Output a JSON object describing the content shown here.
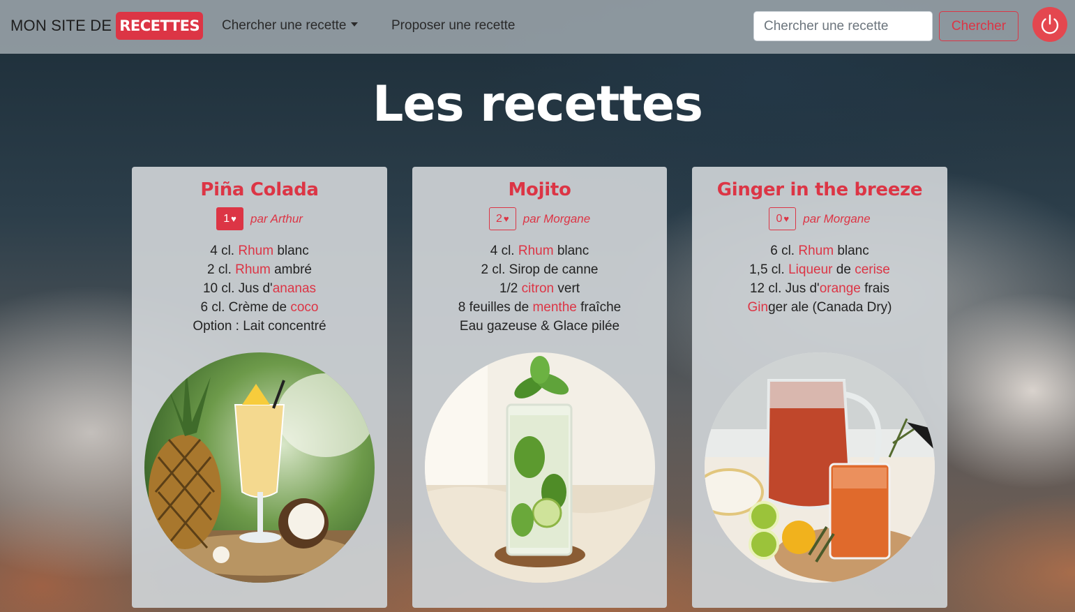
{
  "navbar": {
    "brand_prefix": "MON SITE DE",
    "brand_badge": "RECETTES",
    "menu_search_recipe": "Chercher une recette",
    "menu_propose_recipe": "Proposer une recette",
    "search_placeholder": "Chercher une recette",
    "search_button": "Chercher",
    "power_icon": "power-icon"
  },
  "page": {
    "title": "Les recettes"
  },
  "colors": {
    "accent": "#dc3545",
    "navbar": "#96a0a6",
    "card": "#ced2d5"
  },
  "recipes": [
    {
      "title": "Piña Colada",
      "likes": "1",
      "likes_filled": true,
      "author": "par Arthur",
      "ingredients": [
        [
          {
            "t": "4 cl. "
          },
          {
            "t": "Rhum",
            "h": true
          },
          {
            "t": " blanc"
          }
        ],
        [
          {
            "t": "2 cl. "
          },
          {
            "t": "Rhum",
            "h": true
          },
          {
            "t": " ambré"
          }
        ],
        [
          {
            "t": "10 cl. Jus d'"
          },
          {
            "t": "ananas",
            "h": true
          }
        ],
        [
          {
            "t": "6 cl. Crème de "
          },
          {
            "t": "coco",
            "h": true
          }
        ],
        [
          {
            "t": "Option : Lait concentré"
          }
        ]
      ],
      "image": "pina-colada-photo"
    },
    {
      "title": "Mojito",
      "likes": "2",
      "likes_filled": false,
      "author": "par Morgane",
      "ingredients": [
        [
          {
            "t": "4 cl. "
          },
          {
            "t": "Rhum",
            "h": true
          },
          {
            "t": " blanc"
          }
        ],
        [
          {
            "t": "2 cl. Sirop de canne"
          }
        ],
        [
          {
            "t": "1/2 "
          },
          {
            "t": "citron",
            "h": true
          },
          {
            "t": " vert"
          }
        ],
        [
          {
            "t": "8 feuilles de "
          },
          {
            "t": "menthe",
            "h": true
          },
          {
            "t": " fraîche"
          }
        ],
        [
          {
            "t": "Eau gazeuse & Glace pilée"
          }
        ]
      ],
      "image": "mojito-photo"
    },
    {
      "title": "Ginger in the breeze",
      "likes": "0",
      "likes_filled": false,
      "author": "par Morgane",
      "ingredients": [
        [
          {
            "t": "6 cl. "
          },
          {
            "t": "Rhum",
            "h": true
          },
          {
            "t": " blanc"
          }
        ],
        [
          {
            "t": "1,5 cl. "
          },
          {
            "t": "Liqueur",
            "h": true
          },
          {
            "t": " de "
          },
          {
            "t": "cerise",
            "h": true
          }
        ],
        [
          {
            "t": "12 cl. Jus d'"
          },
          {
            "t": "orange",
            "h": true
          },
          {
            "t": " frais"
          }
        ],
        [
          {
            "t": "Gin",
            "h": true
          },
          {
            "t": "ger ale (Canada Dry)"
          }
        ]
      ],
      "image": "ginger-breeze-photo"
    }
  ]
}
